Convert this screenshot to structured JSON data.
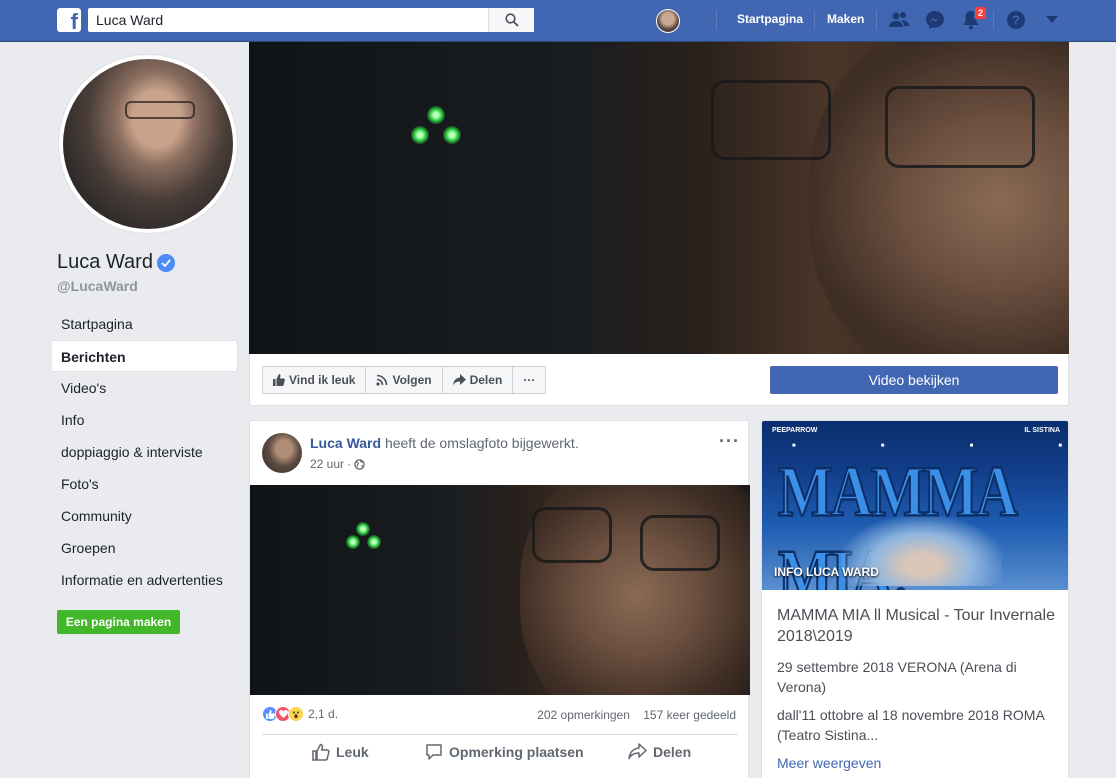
{
  "header": {
    "logo": "f",
    "search_value": "Luca Ward",
    "nav_home": "Startpagina",
    "nav_create": "Maken",
    "notifications_count": "2"
  },
  "profile": {
    "name": "Luca Ward",
    "handle": "@LucaWard"
  },
  "sidebar": {
    "items": [
      {
        "label": "Startpagina"
      },
      {
        "label": "Berichten"
      },
      {
        "label": "Video's"
      },
      {
        "label": "Info"
      },
      {
        "label": "doppiaggio & interviste"
      },
      {
        "label": "Foto's"
      },
      {
        "label": "Community"
      },
      {
        "label": "Groepen"
      },
      {
        "label": "Informatie en advertenties"
      }
    ],
    "active_index": 1,
    "create_page_label": "Een pagina maken"
  },
  "cover_actions": {
    "like": "Vind ik leuk",
    "follow": "Volgen",
    "share": "Delen",
    "more": "···",
    "watch_video": "Video bekijken"
  },
  "post": {
    "author": "Luca Ward",
    "action_text": "heeft de omslagfoto bijgewerkt.",
    "time": "22 uur",
    "reactions_count": "2,1 d.",
    "comments": "202 opmerkingen",
    "shares": "157 keer gedeeld",
    "like_label": "Leuk",
    "comment_label": "Opmerking plaatsen",
    "share_label": "Delen"
  },
  "card": {
    "poster_brand_left": "PEEPARROW",
    "poster_brand_right": "IL SISTINA",
    "poster_title": "MAMMA MIA!",
    "poster_caption": "INFO LUCA WARD",
    "title": "MAMMA MIA ll Musical - Tour Invernale 2018\\2019",
    "line1": "29 settembre 2018 VERONA (Arena di Verona)",
    "line2": "dall'11 ottobre al 18 novembre 2018 ROMA (Teatro Sistina...",
    "more": "Meer weergeven"
  },
  "colors": {
    "brand": "#4267b2",
    "link": "#365899",
    "create_button": "#42b72a",
    "badge": "#fa3e3e",
    "goggles": "#2ecc40"
  }
}
